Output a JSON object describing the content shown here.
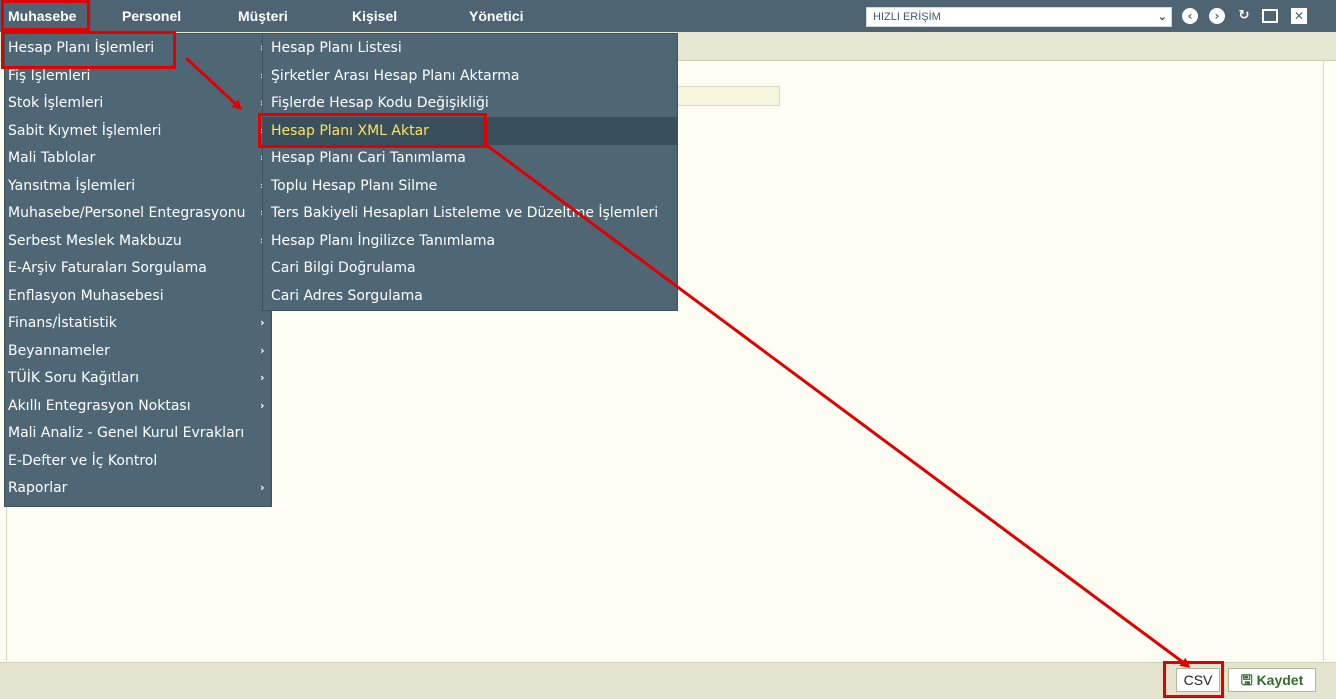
{
  "topbar": {
    "menu": [
      "Muhasebe",
      "Personel",
      "Müşteri",
      "Kişisel",
      "Yönetici"
    ],
    "quick_access": {
      "value": "HIZLI ERİŞİM",
      "chevron": "⌄"
    },
    "icons": [
      "chevron-left-icon",
      "chevron-right-icon",
      "refresh-icon",
      "maximize-icon",
      "close-icon"
    ]
  },
  "main_menu": {
    "items": [
      {
        "label": "Hesap Planı İşlemleri",
        "arrow": "›"
      },
      {
        "label": "Fiş İşlemleri",
        "arrow": "›"
      },
      {
        "label": "Stok İşlemleri",
        "arrow": "›"
      },
      {
        "label": "Sabit Kıymet İşlemleri",
        "arrow": "›"
      },
      {
        "label": "Mali Tablolar",
        "arrow": "›"
      },
      {
        "label": "Yansıtma İşlemleri",
        "arrow": "›"
      },
      {
        "label": "Muhasebe/Personel Entegrasyonu",
        "arrow": "›"
      },
      {
        "label": "Serbest Meslek Makbuzu",
        "arrow": "›"
      },
      {
        "label": "E-Arşiv Faturaları Sorgulama",
        "arrow": ""
      },
      {
        "label": "Enflasyon Muhasebesi",
        "arrow": ""
      },
      {
        "label": "Finans/İstatistik",
        "arrow": "›"
      },
      {
        "label": "Beyannameler",
        "arrow": "›"
      },
      {
        "label": "TÜİK Soru Kağıtları",
        "arrow": "›"
      },
      {
        "label": "Akıllı Entegrasyon Noktası",
        "arrow": "›"
      },
      {
        "label": "Mali Analiz - Genel Kurul Evrakları",
        "arrow": ""
      },
      {
        "label": "E-Defter ve İç Kontrol",
        "arrow": ""
      },
      {
        "label": "Raporlar",
        "arrow": "›"
      }
    ]
  },
  "sub_menu": {
    "items": [
      {
        "label": "Hesap Planı Listesi"
      },
      {
        "label": "Şirketler Arası Hesap Planı Aktarma"
      },
      {
        "label": "Fişlerde Hesap Kodu Değişikliği"
      },
      {
        "label": "Hesap Planı XML Aktar"
      },
      {
        "label": "Hesap Planı Cari Tanımlama"
      },
      {
        "label": "Toplu Hesap Planı Silme"
      },
      {
        "label": "Ters Bakiyeli Hesapları Listeleme ve Düzeltme İşlemleri"
      },
      {
        "label": "Hesap Planı İngilizce Tanımlama"
      },
      {
        "label": "Cari Bilgi Doğrulama"
      },
      {
        "label": "Cari Adres Sorgulama"
      }
    ],
    "highlighted_index": 3
  },
  "footer": {
    "csv_label": "CSV",
    "save_label": "Kaydet",
    "save_icon": "floppy-icon"
  },
  "colors": {
    "topbar": "#4e6472",
    "menu_bg": "#4f6675",
    "highlight_text": "#ffe35a",
    "annotation": "#e00000",
    "save_text": "#2f6d2f"
  }
}
